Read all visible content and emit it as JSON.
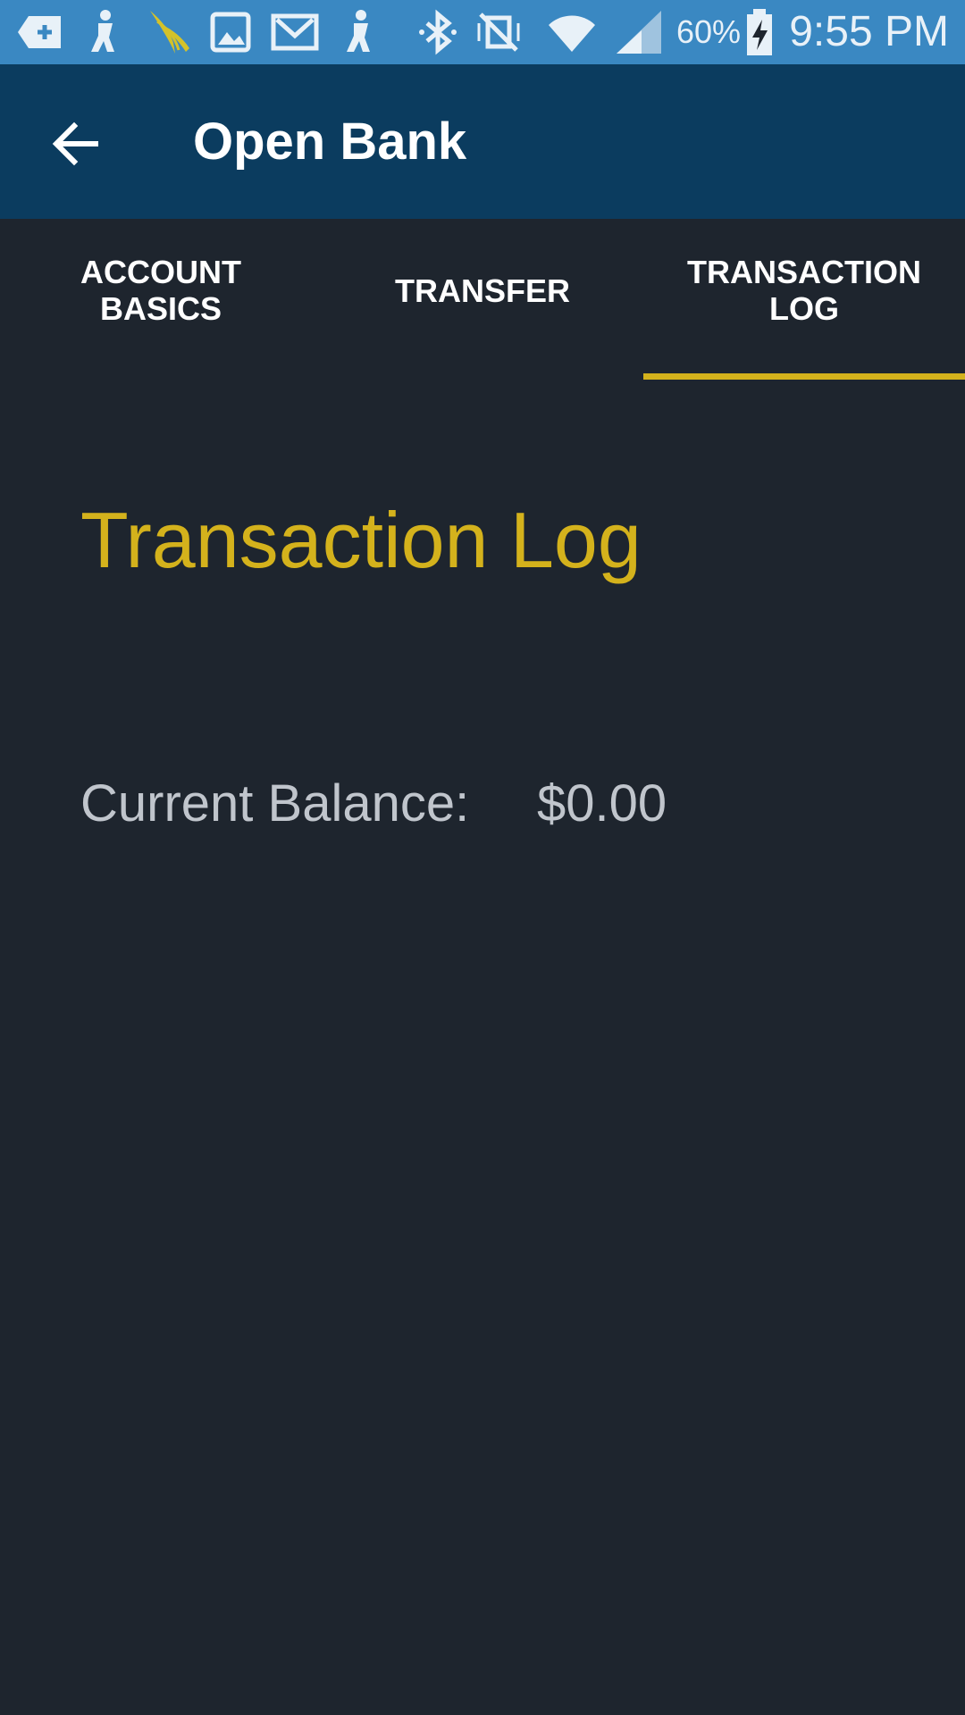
{
  "status_bar": {
    "icons": [
      "add-message-icon",
      "accessibility-person-icon",
      "sprint-logo-icon",
      "image-icon",
      "gmail-icon",
      "accessibility-person-icon",
      "bluetooth-icon",
      "vibrate-mute-icon",
      "wifi-icon",
      "cell-signal-icon",
      "battery-charging-icon"
    ],
    "battery_percent": "60%",
    "time": "9:55 PM",
    "background_color": "#3a88c2"
  },
  "app_bar": {
    "back_icon": "arrow-back-icon",
    "title": "Open Bank",
    "background_color": "#0b3c5f"
  },
  "tabs": [
    {
      "label": "ACCOUNT\nBASICS",
      "selected": false
    },
    {
      "label": "TRANSFER",
      "selected": false
    },
    {
      "label": "TRANSACTION\nLOG",
      "selected": true
    }
  ],
  "content": {
    "title": "Transaction Log",
    "balance_label": "Current Balance:",
    "balance_value": "$0.00"
  },
  "colors": {
    "accent": "#d4b21c",
    "background": "#1e252e",
    "muted_text": "#c0c5cc"
  }
}
